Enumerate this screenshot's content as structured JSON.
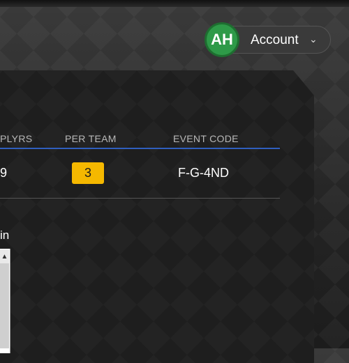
{
  "account": {
    "initials": "AH",
    "label": "Account",
    "chevron": "⌄"
  },
  "table": {
    "headers": [
      "PLYRS",
      "PER TEAM",
      "EVENT CODE"
    ],
    "row": {
      "plyrs": "9",
      "per_team": "3",
      "event_code": "F-G-4ND"
    }
  },
  "below": {
    "label_fragment": "in"
  },
  "colors": {
    "accent_line": "#2f5fbf",
    "badge": "#f5b800",
    "avatar": "#2e9a48"
  },
  "icons": {
    "chevron": "chevron-down-icon",
    "scroll_up": "scroll-up-arrow-icon"
  }
}
